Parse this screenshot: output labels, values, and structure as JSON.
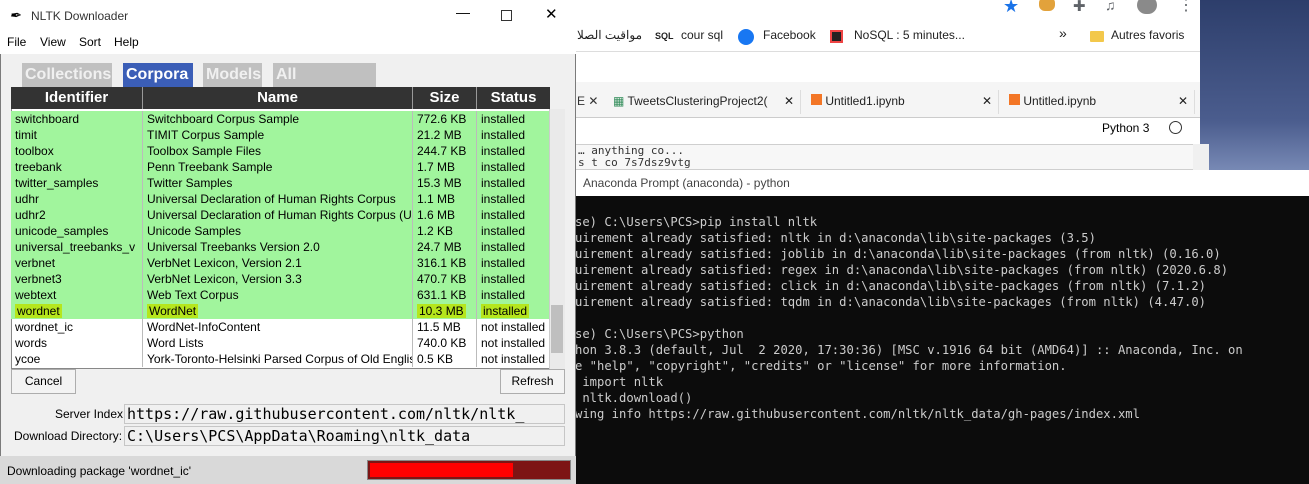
{
  "nltk": {
    "title": "NLTK Downloader",
    "menu": [
      "File",
      "View",
      "Sort",
      "Help"
    ],
    "tabs": [
      "Collections",
      "Corpora",
      "Models",
      "All Packages"
    ],
    "active_tab": "Corpora",
    "columns": [
      "Identifier",
      "Name",
      "Size",
      "Status"
    ],
    "rows": [
      {
        "id": "switchboard",
        "name": "Switchboard Corpus Sample",
        "size": "772.6 KB",
        "status": "installed"
      },
      {
        "id": "timit",
        "name": "TIMIT Corpus Sample",
        "size": "21.2 MB",
        "status": "installed"
      },
      {
        "id": "toolbox",
        "name": "Toolbox Sample Files",
        "size": "244.7 KB",
        "status": "installed"
      },
      {
        "id": "treebank",
        "name": "Penn Treebank Sample",
        "size": "1.7 MB",
        "status": "installed"
      },
      {
        "id": "twitter_samples",
        "name": "Twitter Samples",
        "size": "15.3 MB",
        "status": "installed"
      },
      {
        "id": "udhr",
        "name": "Universal Declaration of Human Rights Corpus",
        "size": "1.1 MB",
        "status": "installed"
      },
      {
        "id": "udhr2",
        "name": "Universal Declaration of Human Rights Corpus (Ur",
        "size": "1.6 MB",
        "status": "installed"
      },
      {
        "id": "unicode_samples",
        "name": "Unicode Samples",
        "size": "1.2 KB",
        "status": "installed"
      },
      {
        "id": "universal_treebanks_v",
        "name": "Universal Treebanks Version 2.0",
        "size": "24.7 MB",
        "status": "installed"
      },
      {
        "id": "verbnet",
        "name": "VerbNet Lexicon, Version 2.1",
        "size": "316.1 KB",
        "status": "installed"
      },
      {
        "id": "verbnet3",
        "name": "VerbNet Lexicon, Version 3.3",
        "size": "470.7 KB",
        "status": "installed"
      },
      {
        "id": "webtext",
        "name": "Web Text Corpus",
        "size": "631.1 KB",
        "status": "installed"
      },
      {
        "id": "wordnet",
        "name": "WordNet",
        "size": "10.3 MB",
        "status": "installed"
      },
      {
        "id": "wordnet_ic",
        "name": "WordNet-InfoContent",
        "size": "11.5 MB",
        "status": "not installed"
      },
      {
        "id": "words",
        "name": "Word Lists",
        "size": "740.0 KB",
        "status": "not installed"
      },
      {
        "id": "ycoe",
        "name": "York-Toronto-Helsinki Parsed Corpus of Old Englis",
        "size": "0.5 KB",
        "status": "not installed"
      }
    ],
    "cancel_label": "Cancel",
    "refresh_label": "Refresh",
    "server_index_label": "Server Index:",
    "server_index_value": "https://raw.githubusercontent.com/nltk/nltk_",
    "download_dir_label": "Download Directory:",
    "download_dir_value": "C:\\Users\\PCS\\AppData\\Roaming\\nltk_data",
    "status_text": "Downloading package 'wordnet_ic'",
    "progress": 0.72,
    "colors": {
      "installed": "#a1f59d",
      "highlight": "#b5e61d",
      "tab_active": "#3b5eb7",
      "progress": "#ff0000"
    }
  },
  "chrome": {
    "bookmarks": [
      "مواقيت الصلا",
      "cour sql",
      "Facebook",
      "NoSQL : 5 minutes...",
      "Autres favoris"
    ],
    "sql_badge": "SQL",
    "more": "»"
  },
  "jupyter": {
    "tabs": [
      "TweetsClusteringProject2(",
      "Untitled1.ipynb",
      "Untitled.ipynb"
    ],
    "kernel": "Python 3",
    "code_lines": [
      "… anything co...",
      "s t co 7s7dsz9vtg"
    ]
  },
  "anaconda": {
    "title": "Anaconda Prompt (anaconda) - python",
    "lines": [
      "se) C:\\Users\\PCS>pip install nltk",
      "uirement already satisfied: nltk in d:\\anaconda\\lib\\site-packages (3.5)",
      "uirement already satisfied: joblib in d:\\anaconda\\lib\\site-packages (from nltk) (0.16.0)",
      "uirement already satisfied: regex in d:\\anaconda\\lib\\site-packages (from nltk) (2020.6.8)",
      "uirement already satisfied: click in d:\\anaconda\\lib\\site-packages (from nltk) (7.1.2)",
      "uirement already satisfied: tqdm in d:\\anaconda\\lib\\site-packages (from nltk) (4.47.0)",
      "",
      "se) C:\\Users\\PCS>python",
      "hon 3.8.3 (default, Jul  2 2020, 17:30:36) [MSC v.1916 64 bit (AMD64)] :: Anaconda, Inc. on",
      "e \"help\", \"copyright\", \"credits\" or \"license\" for more information.",
      " import nltk",
      " nltk.download()",
      "wing info https://raw.githubusercontent.com/nltk/nltk_data/gh-pages/index.xml"
    ]
  }
}
